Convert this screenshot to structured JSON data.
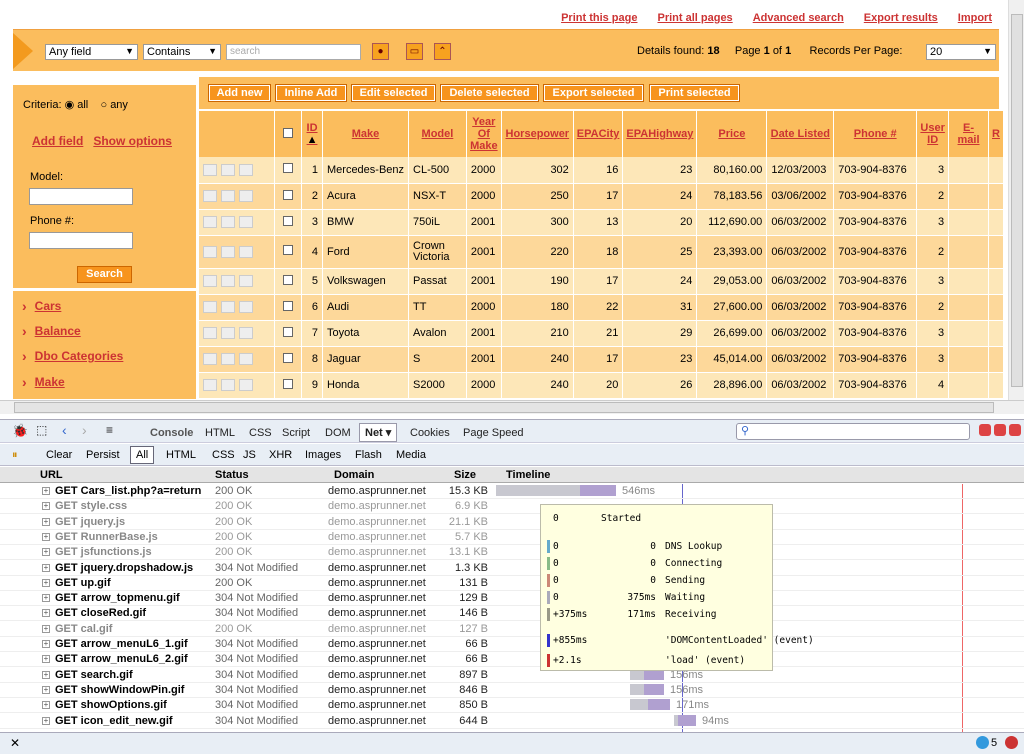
{
  "toplinks": [
    "Print this page",
    "Print all pages",
    "Advanced search",
    "Export results",
    "Import"
  ],
  "search": {
    "field": "Any field",
    "op": "Contains",
    "placeholder": "search"
  },
  "details": {
    "label": "Details found:",
    "count": "18",
    "page_label": "Page",
    "page": "1",
    "of": "of",
    "pages": "1",
    "rpp_label": "Records Per Page:",
    "rpp": "20"
  },
  "left": {
    "criteria": "Criteria:",
    "all": "all",
    "any": "any",
    "add_field": "Add field",
    "show_options": "Show options",
    "model": "Model:",
    "phone": "Phone #:",
    "search_btn": "Search"
  },
  "nav": [
    "Cars",
    "Balance",
    "Dbo Categories",
    "Make"
  ],
  "actions": [
    "Add new",
    "Inline Add",
    "Edit selected",
    "Delete selected",
    "Export selected",
    "Print selected"
  ],
  "columns": [
    "ID",
    "Make",
    "Model",
    "Year Of Make",
    "Horsepower",
    "EPACity",
    "EPAHighway",
    "Price",
    "Date Listed",
    "Phone #",
    "User ID",
    "E-mail",
    "R"
  ],
  "rows": [
    [
      "1",
      "Mercedes-Benz",
      "CL-500",
      "2000",
      "302",
      "16",
      "23",
      "80,160.00",
      "12/03/2003",
      "703-904-8376",
      "3"
    ],
    [
      "2",
      "Acura",
      "NSX-T",
      "2000",
      "250",
      "17",
      "24",
      "78,183.56",
      "03/06/2002",
      "703-904-8376",
      "2"
    ],
    [
      "3",
      "BMW",
      "750iL",
      "2001",
      "300",
      "13",
      "20",
      "112,690.00",
      "06/03/2002",
      "703-904-8376",
      "3"
    ],
    [
      "4",
      "Ford",
      "Crown Victoria",
      "2001",
      "220",
      "18",
      "25",
      "23,393.00",
      "06/03/2002",
      "703-904-8376",
      "2"
    ],
    [
      "5",
      "Volkswagen",
      "Passat",
      "2001",
      "190",
      "17",
      "24",
      "29,053.00",
      "06/03/2002",
      "703-904-8376",
      "3"
    ],
    [
      "6",
      "Audi",
      "TT",
      "2000",
      "180",
      "22",
      "31",
      "27,600.00",
      "06/03/2002",
      "703-904-8376",
      "2"
    ],
    [
      "7",
      "Toyota",
      "Avalon",
      "2001",
      "210",
      "21",
      "29",
      "26,699.00",
      "06/03/2002",
      "703-904-8376",
      "3"
    ],
    [
      "8",
      "Jaguar",
      "S",
      "2001",
      "240",
      "17",
      "23",
      "45,014.00",
      "06/03/2002",
      "703-904-8376",
      "3"
    ],
    [
      "9",
      "Honda",
      "S2000",
      "2000",
      "240",
      "20",
      "26",
      "28,896.00",
      "06/03/2002",
      "703-904-8376",
      "4"
    ]
  ],
  "fb_tabs": [
    "Console",
    "HTML",
    "CSS",
    "Script",
    "DOM",
    "Net",
    "Cookies",
    "Page Speed"
  ],
  "fb_sub": [
    "Clear",
    "Persist",
    "All",
    "HTML",
    "CSS",
    "JS",
    "XHR",
    "Images",
    "Flash",
    "Media"
  ],
  "net_headers": [
    "URL",
    "Status",
    "Domain",
    "Size",
    "Timeline"
  ],
  "net_rows": [
    {
      "url": "GET Cars_list.php?a=return",
      "status": "200 OK",
      "domain": "demo.asprunner.net",
      "size": "15.3 KB",
      "cached": false,
      "time": "546ms"
    },
    {
      "url": "GET style.css",
      "status": "200 OK",
      "domain": "demo.asprunner.net",
      "size": "6.9 KB",
      "cached": true,
      "time": ""
    },
    {
      "url": "GET jquery.js",
      "status": "200 OK",
      "domain": "demo.asprunner.net",
      "size": "21.1 KB",
      "cached": true,
      "time": ""
    },
    {
      "url": "GET RunnerBase.js",
      "status": "200 OK",
      "domain": "demo.asprunner.net",
      "size": "5.7 KB",
      "cached": true,
      "time": ""
    },
    {
      "url": "GET jsfunctions.js",
      "status": "200 OK",
      "domain": "demo.asprunner.net",
      "size": "13.1 KB",
      "cached": true,
      "time": ""
    },
    {
      "url": "GET jquery.dropshadow.js",
      "status": "304 Not Modified",
      "domain": "demo.asprunner.net",
      "size": "1.3 KB",
      "cached": false,
      "time": ""
    },
    {
      "url": "GET up.gif",
      "status": "200 OK",
      "domain": "demo.asprunner.net",
      "size": "131 B",
      "cached": false,
      "time": ""
    },
    {
      "url": "GET arrow_topmenu.gif",
      "status": "304 Not Modified",
      "domain": "demo.asprunner.net",
      "size": "129 B",
      "cached": false,
      "time": ""
    },
    {
      "url": "GET closeRed.gif",
      "status": "304 Not Modified",
      "domain": "demo.asprunner.net",
      "size": "146 B",
      "cached": false,
      "time": ""
    },
    {
      "url": "GET cal.gif",
      "status": "200 OK",
      "domain": "demo.asprunner.net",
      "size": "127 B",
      "cached": true,
      "time": ""
    },
    {
      "url": "GET arrow_menuL6_1.gif",
      "status": "304 Not Modified",
      "domain": "demo.asprunner.net",
      "size": "66 B",
      "cached": false,
      "time": ""
    },
    {
      "url": "GET arrow_menuL6_2.gif",
      "status": "304 Not Modified",
      "domain": "demo.asprunner.net",
      "size": "66 B",
      "cached": false,
      "time": ""
    },
    {
      "url": "GET search.gif",
      "status": "304 Not Modified",
      "domain": "demo.asprunner.net",
      "size": "897 B",
      "cached": false,
      "time": "156ms"
    },
    {
      "url": "GET showWindowPin.gif",
      "status": "304 Not Modified",
      "domain": "demo.asprunner.net",
      "size": "846 B",
      "cached": false,
      "time": "156ms"
    },
    {
      "url": "GET showOptions.gif",
      "status": "304 Not Modified",
      "domain": "demo.asprunner.net",
      "size": "850 B",
      "cached": false,
      "time": "171ms"
    },
    {
      "url": "GET icon_edit_new.gif",
      "status": "304 Not Modified",
      "domain": "demo.asprunner.net",
      "size": "644 B",
      "cached": false,
      "time": "94ms"
    }
  ],
  "popup": [
    {
      "a": "0",
      "b": "",
      "c": "Started"
    },
    {
      "a": "0",
      "b": "0",
      "c": "DNS Lookup"
    },
    {
      "a": "0",
      "b": "0",
      "c": "Connecting"
    },
    {
      "a": "0",
      "b": "0",
      "c": "Sending"
    },
    {
      "a": "0",
      "b": "375ms",
      "c": "Waiting"
    },
    {
      "a": "+375ms",
      "b": "171ms",
      "c": "Receiving"
    },
    {
      "a": "+855ms",
      "b": "",
      "c": "'DOMContentLoaded' (event)"
    },
    {
      "a": "+2.1s",
      "b": "",
      "c": "'load' (event)"
    }
  ],
  "status_count": "5"
}
